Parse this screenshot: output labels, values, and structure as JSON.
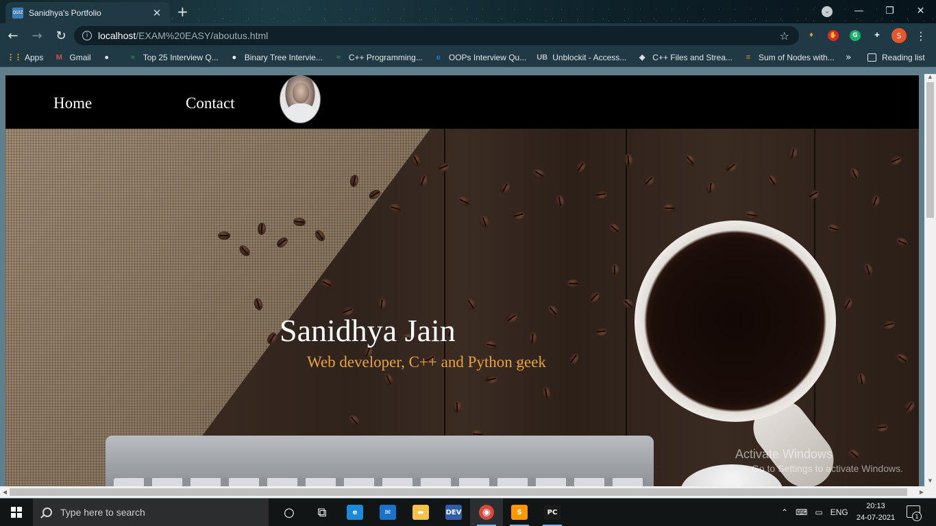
{
  "browser": {
    "tab": {
      "favicon_text": "QUIZ",
      "title": "Sanidhya's Portfolio",
      "close": "✕"
    },
    "new_tab": "+",
    "profile_dot": "⌄",
    "window_controls": {
      "minimize": "—",
      "maximize": "❐",
      "close": "✕"
    },
    "toolbar": {
      "back": "←",
      "forward": "→",
      "reload": "↻"
    },
    "address": {
      "host": "localhost",
      "path": "/EXAM%20EASY/aboutus.html",
      "info": "i",
      "star": "☆"
    },
    "extensions": [
      {
        "name": "location-extension",
        "glyph": "♦",
        "color": "#c8a43a"
      },
      {
        "name": "adblock-extension",
        "glyph": "✋",
        "color": "#e0262d"
      },
      {
        "name": "grammarly-extension",
        "glyph": "G",
        "color": "#17b36b"
      },
      {
        "name": "extensions-puzzle",
        "glyph": "✚",
        "color": "#dfe6e8"
      }
    ],
    "profile_avatar": "S",
    "menu": "⋮"
  },
  "bookmarks": {
    "items": [
      {
        "label": "Apps",
        "icon": "apps-grid-icon",
        "glyph": "⋮⋮",
        "color": "#f2b23b"
      },
      {
        "label": "Gmail",
        "icon": "gmail-icon",
        "glyph": "M",
        "color": "#e8453c"
      },
      {
        "label": "",
        "icon": "globe-icon",
        "glyph": "●",
        "color": "#e3e9eb"
      },
      {
        "label": "Top 25 Interview Q...",
        "icon": "gfg-icon",
        "glyph": "≈",
        "color": "#2f8d46"
      },
      {
        "label": "Binary Tree Intervie...",
        "icon": "medium-icon",
        "glyph": "●",
        "color": "#ffffff"
      },
      {
        "label": "C++ Programming...",
        "icon": "gfg-icon-2",
        "glyph": "≈",
        "color": "#2f8d46"
      },
      {
        "label": "OOPs Interview Qu...",
        "icon": "edureka-icon",
        "glyph": "e",
        "color": "#1f78d1"
      },
      {
        "label": "Unblockit - Access...",
        "icon": "unblockit-icon",
        "glyph": "UB",
        "color": "#bcbcbc"
      },
      {
        "label": "C++ Files and Strea...",
        "icon": "tutorialspoint-icon",
        "glyph": "◈",
        "color": "#e3e9eb"
      },
      {
        "label": "Sum of Nodes with...",
        "icon": "stackoverflow-icon",
        "glyph": "≡",
        "color": "#f48024"
      }
    ],
    "more": "»",
    "reading_list": "Reading list"
  },
  "site": {
    "nav": {
      "home": "Home",
      "contact": "Contact"
    },
    "hero": {
      "name": "Sanidhya Jain",
      "tagline": "Web developer, C++ and Python geek"
    }
  },
  "watermark": {
    "line1": "Activate Windows",
    "line2": "Go to Settings to activate Windows."
  },
  "scrollbars": {
    "up": "▲",
    "down": "▼",
    "left": "◀",
    "right": "▶"
  },
  "taskbar": {
    "search_placeholder": "Type here to search",
    "apps": [
      {
        "name": "cortana",
        "glyph": "○",
        "bg": "transparent"
      },
      {
        "name": "task-view",
        "glyph": "⧉",
        "bg": "transparent"
      },
      {
        "name": "edge",
        "glyph": "e",
        "bg": "#1b8ad8"
      },
      {
        "name": "mail",
        "glyph": "✉",
        "bg": "#1a73c9"
      },
      {
        "name": "file-explorer",
        "glyph": "▬",
        "bg": "#f3c24a"
      },
      {
        "name": "devcpp",
        "glyph": "DEV",
        "bg": "#2f5fa8"
      },
      {
        "name": "chrome",
        "glyph": "◉",
        "bg": "#d9483b"
      },
      {
        "name": "sublime-text",
        "glyph": "S",
        "bg": "#ff9800"
      },
      {
        "name": "pycharm",
        "glyph": "PC",
        "bg": "#1a1a1a"
      }
    ],
    "tray": {
      "chevron": "⌃",
      "network": "⌨",
      "battery": "▭",
      "lang": "ENG"
    },
    "clock": {
      "time": "20:13",
      "date": "24-07-2021"
    },
    "notifications": "1"
  }
}
